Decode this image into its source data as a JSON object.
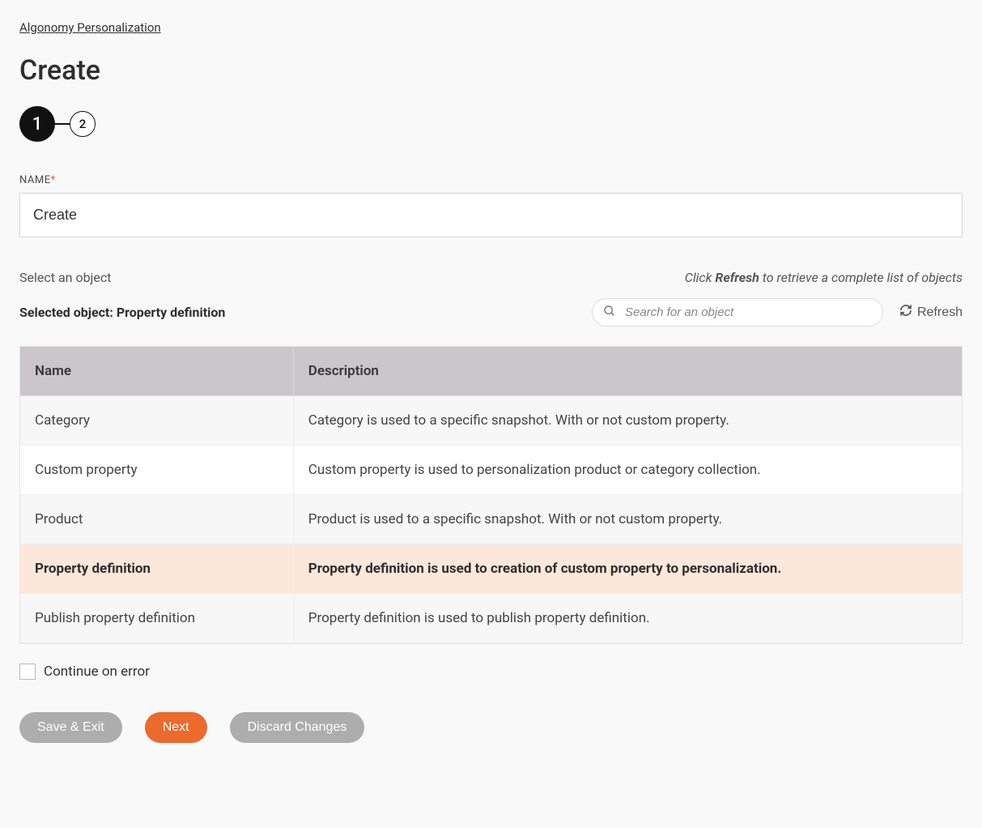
{
  "breadcrumb": {
    "label": "Algonomy Personalization"
  },
  "page": {
    "title": "Create"
  },
  "stepper": {
    "steps": [
      "1",
      "2"
    ],
    "active_index": 0
  },
  "form": {
    "name_label": "NAME",
    "name_value": "Create"
  },
  "object_section": {
    "select_label": "Select an object",
    "refresh_hint_prefix": "Click ",
    "refresh_hint_bold": "Refresh",
    "refresh_hint_suffix": " to retrieve a complete list of objects",
    "selected_prefix": "Selected object: ",
    "selected_value": "Property definition",
    "search_placeholder": "Search for an object",
    "refresh_button": "Refresh"
  },
  "table": {
    "headers": [
      "Name",
      "Description"
    ],
    "rows": [
      {
        "name": "Category",
        "description": "Category is used to a specific snapshot. With or not custom property.",
        "selected": false
      },
      {
        "name": "Custom property",
        "description": "Custom property is used to personalization product or category collection.",
        "selected": false
      },
      {
        "name": "Product",
        "description": "Product is used to a specific snapshot. With or not custom property.",
        "selected": false
      },
      {
        "name": "Property definition",
        "description": "Property definition is used to creation of custom property to personalization.",
        "selected": true
      },
      {
        "name": "Publish property definition",
        "description": "Property definition is used to publish property definition.",
        "selected": false
      }
    ]
  },
  "continue_on_error": {
    "label": "Continue on error",
    "checked": false
  },
  "buttons": {
    "save_exit": "Save & Exit",
    "next": "Next",
    "discard": "Discard Changes"
  }
}
